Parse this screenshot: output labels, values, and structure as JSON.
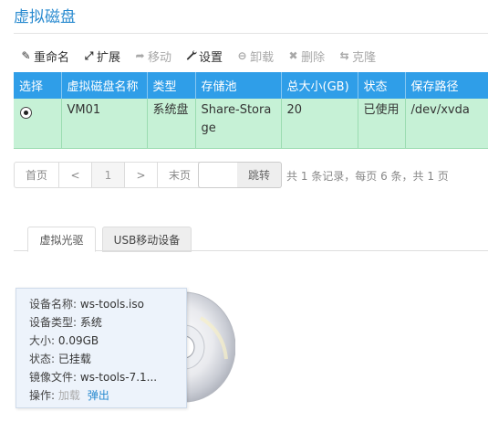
{
  "page": {
    "title": "虚拟磁盘"
  },
  "toolbar": [
    {
      "label": "重命名",
      "icon": "pencil-icon",
      "glyph": "✎",
      "enabled": true
    },
    {
      "label": "扩展",
      "icon": "expand-icon",
      "glyph": "⤢",
      "enabled": true
    },
    {
      "label": "移动",
      "icon": "move-arrow-icon",
      "glyph": "➦",
      "enabled": false
    },
    {
      "label": "设置",
      "icon": "wrench-icon",
      "glyph": "🔧",
      "enabled": true
    },
    {
      "label": "卸载",
      "icon": "minus-circle-icon",
      "glyph": "⊖",
      "enabled": false
    },
    {
      "label": "删除",
      "icon": "close-icon",
      "glyph": "✖",
      "enabled": false
    },
    {
      "label": "克隆",
      "icon": "clone-icon",
      "glyph": "⇆",
      "enabled": false
    }
  ],
  "table": {
    "headers": [
      "选择",
      "虚拟磁盘名称",
      "类型",
      "存储池",
      "总大小(GB)",
      "状态",
      "保存路径"
    ],
    "rows": [
      {
        "selected": true,
        "name": "VM01",
        "type": "系统盘",
        "pool": "Share-Storage",
        "size": "20",
        "status": "已使用",
        "path": "/dev/xvda"
      }
    ]
  },
  "pager": {
    "first": "首页",
    "prev": "<",
    "page": "1",
    "next": ">",
    "last": "末页",
    "jump_value": "",
    "jump_label": "跳转",
    "info": "共 1 条记录，每页 6 条，共 1 页"
  },
  "tabs": [
    {
      "label": "虚拟光驱",
      "active": true
    },
    {
      "label": "USB移动设备",
      "active": false
    }
  ],
  "cdrom": {
    "device_name_label": "设备名称:",
    "device_name": "ws-tools.iso",
    "device_type_label": "设备类型:",
    "device_type": "系统",
    "size_label": "大小:",
    "size": "0.09GB",
    "status_label": "状态:",
    "status": "已挂载",
    "image_file_label": "镜像文件:",
    "image_file": "ws-tools-7.1...",
    "ops_label": "操作:",
    "op_load": "加载",
    "op_eject": "弹出"
  },
  "colors": {
    "accent": "#2a8bd0",
    "header_bg": "#2f9ee8",
    "selected_row_bg": "#c6f1d6"
  }
}
